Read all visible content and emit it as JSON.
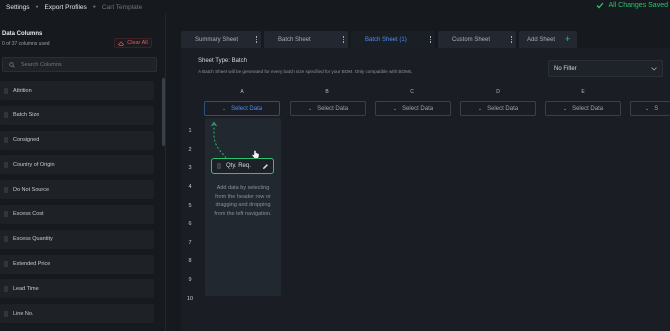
{
  "breadcrumb": {
    "items": [
      "Settings",
      "Export Profiles",
      "Cart Template"
    ],
    "saved": "All Changes Saved"
  },
  "columns_panel": {
    "title": "Data Columns",
    "used": "0 of 37 columns used",
    "clear_all": "Clear All",
    "search_placeholder": "Search Columns",
    "items": [
      "Attrition",
      "Batch Size",
      "Consigned",
      "Country of Origin",
      "Do Not Source",
      "Excess Cost",
      "Excess Quantity",
      "Extended Price",
      "Lead Time",
      "Line No."
    ]
  },
  "tabs": {
    "items": [
      "Summary Sheet",
      "Batch Sheet",
      "Batch Sheet (1)",
      "Custom Sheet"
    ],
    "active_index": 2,
    "add_label": "Add Sheet"
  },
  "sheet": {
    "type_label": "Sheet Type: Batch",
    "description": "A Batch Sheet will be generated for every batch size specified for your BOM. Only compatible with BOMs.",
    "filter_value": "No Filter",
    "column_letters": [
      "A",
      "B",
      "C",
      "D",
      "E"
    ],
    "select_label": "Select Data",
    "select_label_partial": "S",
    "row_numbers": [
      "1",
      "2",
      "3",
      "4",
      "5",
      "6",
      "7",
      "8",
      "9",
      "10"
    ],
    "chip_label": "Qty. Req.",
    "hint": "Add data by selecting from the header row or dragging and dropping from the left navigation."
  },
  "colors": {
    "accent_blue": "#4f8df7",
    "success_green": "#29c56e",
    "danger_red": "#e05a5a",
    "background": "#16191e"
  }
}
